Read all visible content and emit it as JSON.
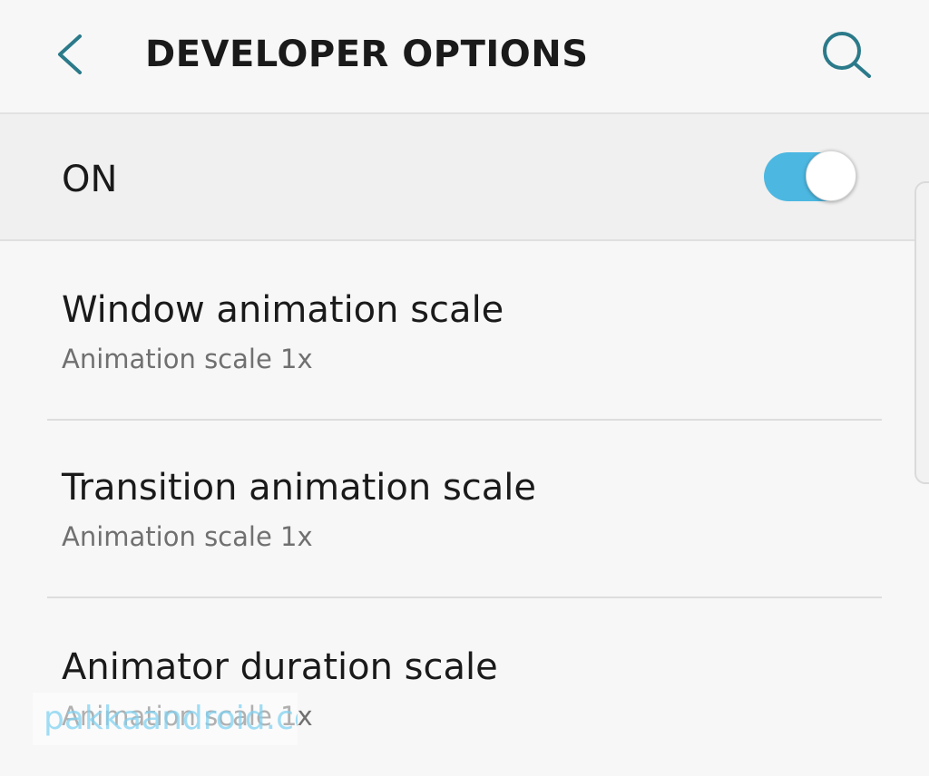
{
  "header": {
    "title": "DEVELOPER OPTIONS",
    "back_icon": "chevron-left-icon",
    "search_icon": "search-icon",
    "accent_color": "#2b7a8a"
  },
  "master_switch": {
    "label": "ON",
    "state": "on",
    "track_color": "#4cb8e2"
  },
  "settings": [
    {
      "title": "Window animation scale",
      "summary": "Animation scale 1x"
    },
    {
      "title": "Transition animation scale",
      "summary": "Animation scale 1x"
    },
    {
      "title": "Animator duration scale",
      "summary": "Animation scale 1x"
    }
  ],
  "watermark": "pakkaandroid.com"
}
